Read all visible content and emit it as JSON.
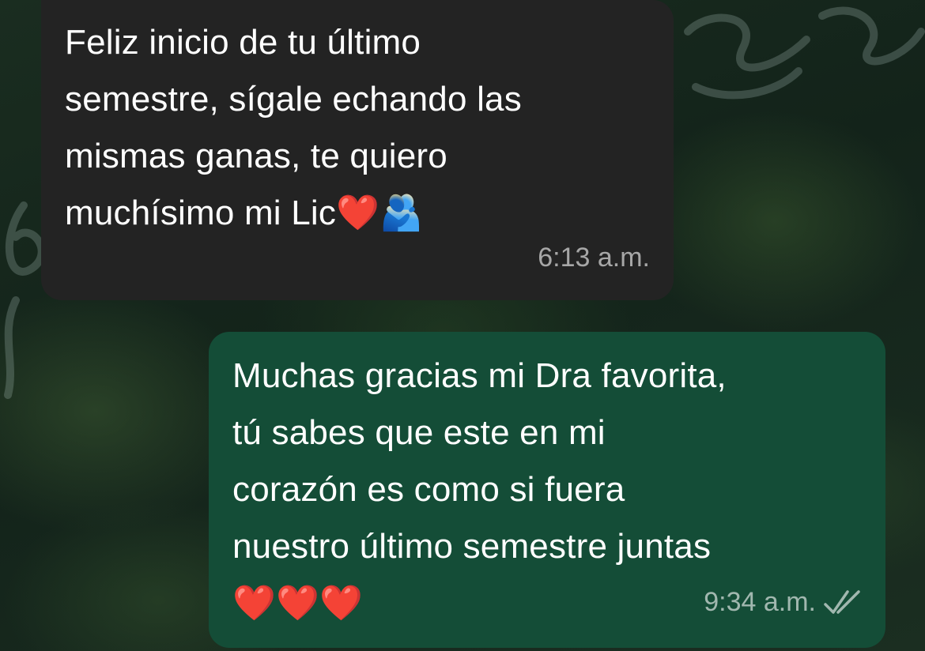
{
  "messages": [
    {
      "direction": "incoming",
      "text": "Feliz inicio de tu último\nsemestre, sígale echando las\nmismas ganas, te quiero\nmuchísimo mi Lic❤️🫂",
      "time": "6:13 a.m."
    },
    {
      "direction": "outgoing",
      "text": "Muchas gracias mi Dra favorita,\ntú sabes que este en mi\ncorazón es como si fuera\nnuestro último semestre juntas\n❤️❤️❤️",
      "time": "9:34 a.m.",
      "status_icon": "double-check-read-icon"
    }
  ],
  "colors": {
    "incoming_bubble": "#232323",
    "outgoing_bubble": "#144d37",
    "wallpaper": "#14251a"
  }
}
